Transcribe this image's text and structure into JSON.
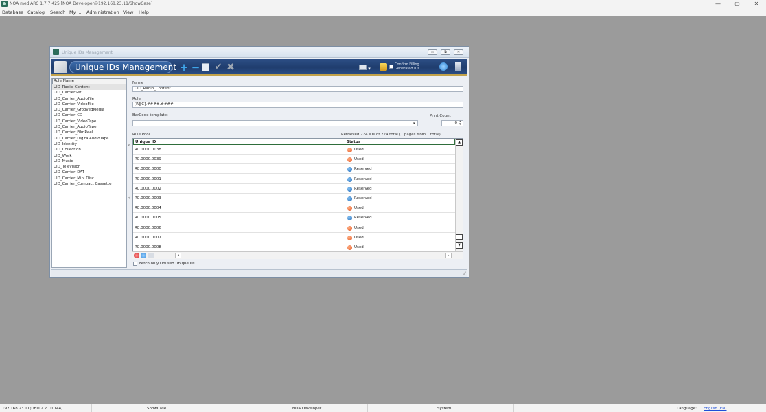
{
  "app": {
    "title": "NOA mediARC 1.7.7.425 [NOA Developer@192.168.23.11/ShowCase]",
    "window_controls": {
      "minimize": "—",
      "maximize": "▢",
      "close": "✕"
    }
  },
  "menu": [
    "Database",
    "Catalog",
    "Search",
    "My ...",
    "Administration",
    "View",
    "Help"
  ],
  "window": {
    "title": "Unique IDs Management",
    "banner_title": "Unique IDs Management",
    "controls": {
      "minimize": "▭",
      "restore": "⧉",
      "close": "✕"
    },
    "toolbar": {
      "confirm_label": "Confirm  Filling Generated IDs"
    }
  },
  "rule_list": {
    "header": "Rule Name",
    "selected_index": 0,
    "items": [
      "UID_Radio_Content",
      "UID_CarrierSet",
      "UID_Carrier_AudioFile",
      "UID_Carrier_VideoFile",
      "UID_Carrier_GroovedMedia",
      "UID_Carrier_CD",
      "UID_Carrier_VideoTape",
      "UID_Carrier_AudioTape",
      "UID_Carrier_FilmReel",
      "UID_Carrier_DigitalAudioTape",
      "UID_Identity",
      "UID_Collection",
      "UID_Work",
      "UID_Music",
      "UID_Television",
      "UID_Carrier_DAT",
      "UID_Carrier_Mini Disc",
      "UID_Carrier_Compact Cassette"
    ]
  },
  "form": {
    "name_label": "Name",
    "name_value": "UID_Radio_Content",
    "rule_label": "Rule",
    "rule_value": "[R][C].####.####",
    "barcode_label": "BarCode template:",
    "barcode_value": "",
    "print_count_label": "Print Count",
    "print_count_value": "0",
    "rule_pool_label": "Rule Pool",
    "retrieved_text": "Retrieved 224 IDs of 224 total (1 pages from 1 total)"
  },
  "pool": {
    "columns": [
      "Unique ID",
      "Status"
    ],
    "rows": [
      {
        "id": "RC.0000.0038",
        "status": "Used"
      },
      {
        "id": "RC.0000.0039",
        "status": "Used"
      },
      {
        "id": "RC.0000.0000",
        "status": "Reserved"
      },
      {
        "id": "RC.0000.0001",
        "status": "Reserved"
      },
      {
        "id": "RC.0000.0002",
        "status": "Reserved"
      },
      {
        "id": "RC.0000.0003",
        "status": "Reserved"
      },
      {
        "id": "RC.0000.0004",
        "status": "Used"
      },
      {
        "id": "RC.0000.0005",
        "status": "Reserved"
      },
      {
        "id": "RC.0000.0006",
        "status": "Used"
      },
      {
        "id": "RC.0000.0007",
        "status": "Used"
      },
      {
        "id": "RC.0000.0008",
        "status": "Used"
      }
    ],
    "status_colors": {
      "Used": "#e5501a",
      "Reserved": "#1b67b6"
    }
  },
  "fetch_unused_label": "Fetch only Unused UniqueIDs",
  "statusbar": {
    "server": "192.168.23.11(DBD 2.2.10.144)",
    "database": "ShowCase",
    "user": "NOA Developer",
    "role": "System",
    "language_label": "Language:",
    "language_value": "English (EN)"
  },
  "colors": {
    "desktop": "#9b9b9b",
    "banner": "#1f3d6e",
    "accent_gold": "#c2a24a",
    "grid_header_border": "#2f6e3b"
  }
}
